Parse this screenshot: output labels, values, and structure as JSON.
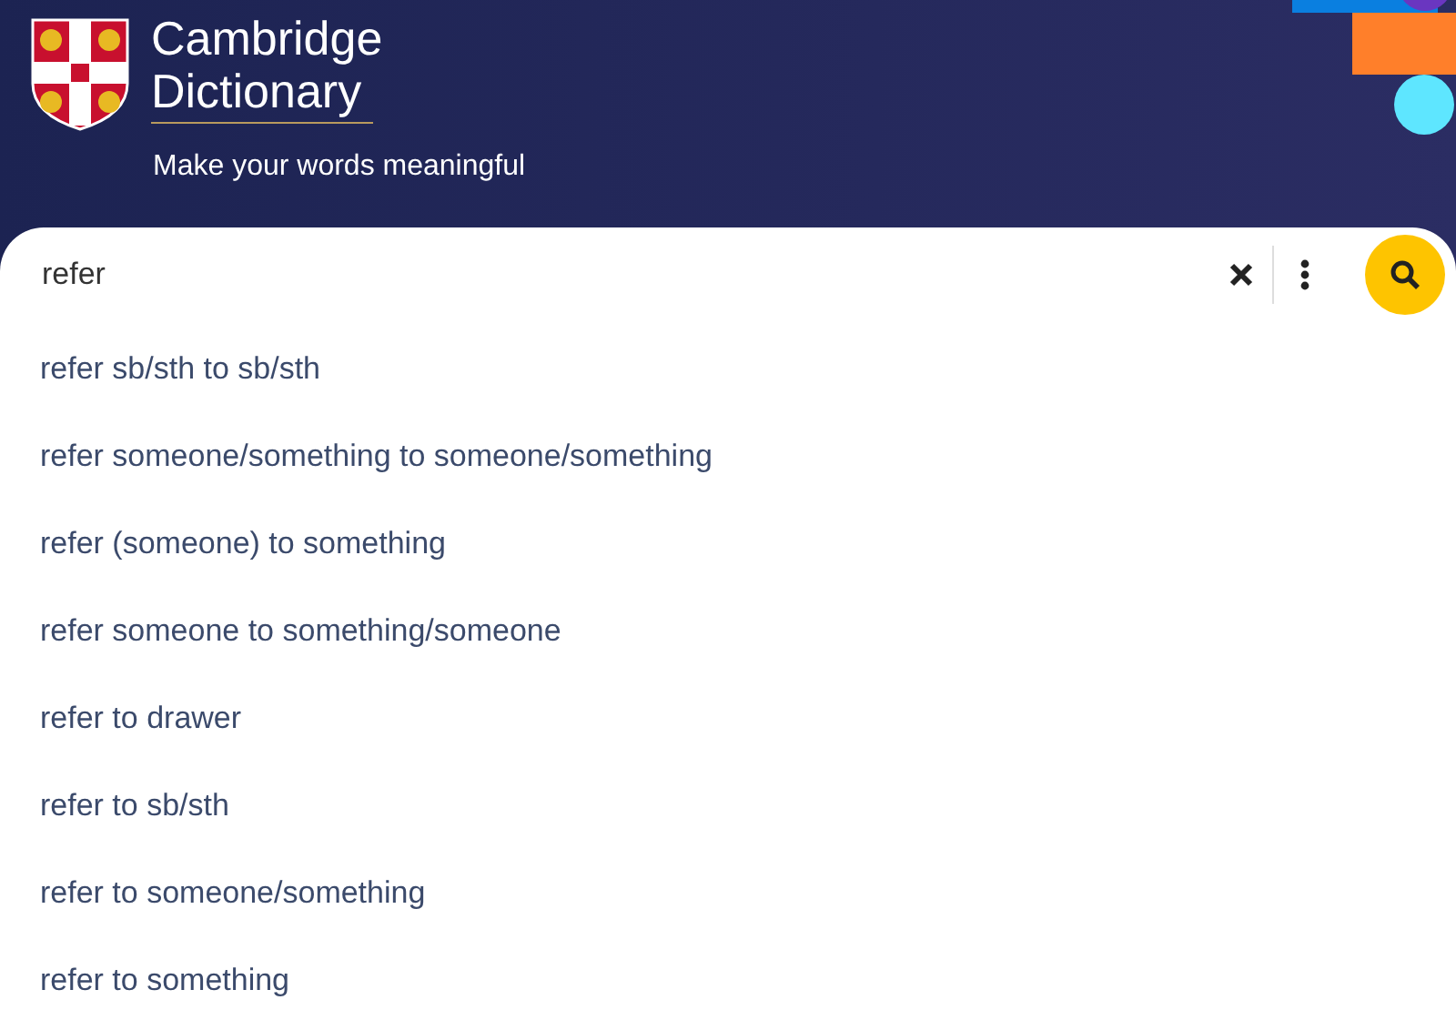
{
  "header": {
    "brand_lines": [
      "Cambridge",
      "Dictionary"
    ],
    "tagline": "Make your words meaningful"
  },
  "search": {
    "value": "refer"
  },
  "suggestions": [
    {
      "text": "refer sb/sth to sb/sth"
    },
    {
      "text": "refer someone/something to someone/something"
    },
    {
      "text": "refer (someone) to something"
    },
    {
      "text": "refer someone to something/someone"
    },
    {
      "text": "refer to drawer"
    },
    {
      "text": "refer to sb/sth"
    },
    {
      "text": "refer to someone/something"
    },
    {
      "text": "refer to something"
    }
  ]
}
